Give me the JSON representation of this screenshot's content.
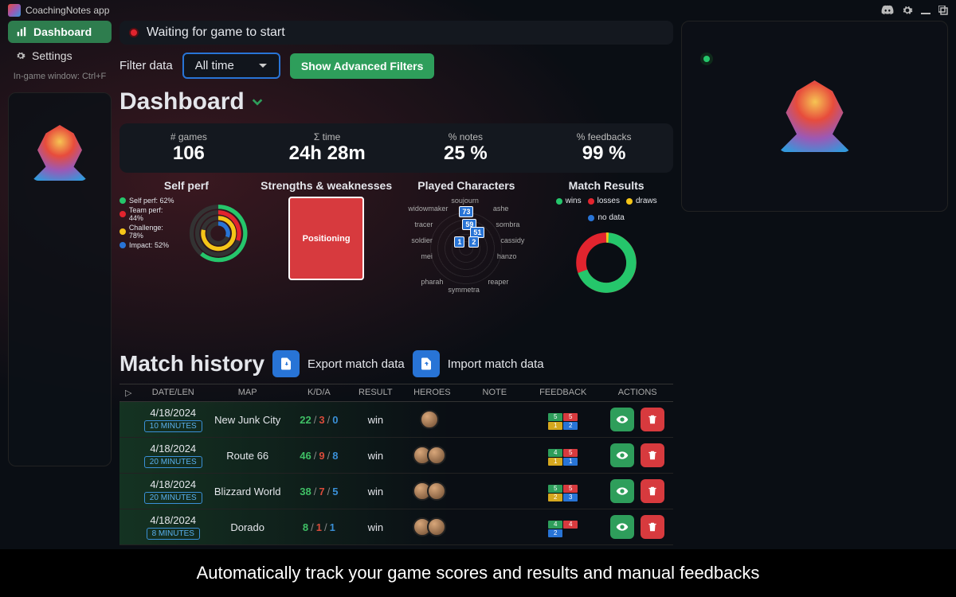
{
  "app": {
    "title": "CoachingNotes app"
  },
  "nav": {
    "dashboard": "Dashboard",
    "settings": "Settings",
    "hint": "In-game window: Ctrl+F"
  },
  "status": {
    "text": "Waiting for game to start"
  },
  "filter": {
    "label": "Filter data",
    "selected": "All time",
    "advanced_btn": "Show Advanced Filters"
  },
  "page": {
    "title": "Dashboard"
  },
  "stats": {
    "games_label": "# games",
    "games_value": "106",
    "time_label": "Σ time",
    "time_value": "24h 28m",
    "notes_label": "% notes",
    "notes_value": "25 %",
    "feedbacks_label": "% feedbacks",
    "feedbacks_value": "99 %"
  },
  "panels": {
    "self_perf": "Self perf",
    "strengths": "Strengths & weaknesses",
    "played_chars": "Played Characters",
    "match_results": "Match Results"
  },
  "self_legend": {
    "a": "Self perf: 62%",
    "b": "Team perf: 44%",
    "c": "Challenge: 78%",
    "d": "Impact: 52%"
  },
  "positioning": "Positioning",
  "radar_labels": {
    "soujourn": "soujourn",
    "ashe": "ashe",
    "sombra": "sombra",
    "cassidy": "cassidy",
    "hanzo": "hanzo",
    "reaper": "reaper",
    "symmetra": "symmetra",
    "pharah": "pharah",
    "mei": "mei",
    "soldier": "soldier",
    "tracer": "tracer",
    "widowmaker": "widowmaker"
  },
  "radar_values": {
    "a": "73",
    "b": "59",
    "c": "51",
    "d": "1",
    "e": "2"
  },
  "match_legend": {
    "wins": "wins",
    "losses": "losses",
    "draws": "draws",
    "nodata": "no data"
  },
  "history": {
    "title": "Match history",
    "export": "Export match data",
    "import": "Import match data"
  },
  "cols": {
    "date": "DATE/LEN",
    "map": "MAP",
    "kda": "K/D/A",
    "result": "RESULT",
    "heroes": "HEROES",
    "note": "NOTE",
    "feedback": "FEEDBACK",
    "actions": "ACTIONS"
  },
  "rows": [
    {
      "date": "4/18/2024",
      "len": "10 MINUTES",
      "map": "New Junk City",
      "k": "22",
      "d": "3",
      "a": "0",
      "result": "win"
    },
    {
      "date": "4/18/2024",
      "len": "20 MINUTES",
      "map": "Route 66",
      "k": "46",
      "d": "9",
      "a": "8",
      "result": "win"
    },
    {
      "date": "4/18/2024",
      "len": "20 MINUTES",
      "map": "Blizzard World",
      "k": "38",
      "d": "7",
      "a": "5",
      "result": "win"
    },
    {
      "date": "4/18/2024",
      "len": "8 MINUTES",
      "map": "Dorado",
      "k": "8",
      "d": "1",
      "a": "1",
      "result": "win"
    }
  ],
  "chart_data": [
    {
      "type": "bar",
      "name": "self_perf_rings",
      "series": [
        {
          "name": "Self perf",
          "values": [
            62
          ],
          "color": "#25c66b"
        },
        {
          "name": "Team perf",
          "values": [
            44
          ],
          "color": "#e2242e"
        },
        {
          "name": "Challenge",
          "values": [
            78
          ],
          "color": "#f5c518"
        },
        {
          "name": "Impact",
          "values": [
            52
          ],
          "color": "#2874d6"
        }
      ],
      "ylim": [
        0,
        100
      ]
    },
    {
      "type": "pie",
      "name": "match_results",
      "categories": [
        "wins",
        "losses",
        "draws",
        "no data"
      ],
      "values": [
        64,
        34,
        1,
        1
      ],
      "colors": [
        "#25c66b",
        "#e2242e",
        "#f5c518",
        "#2874d6"
      ]
    }
  ],
  "caption": "Automatically track your game scores and results and manual feedbacks"
}
